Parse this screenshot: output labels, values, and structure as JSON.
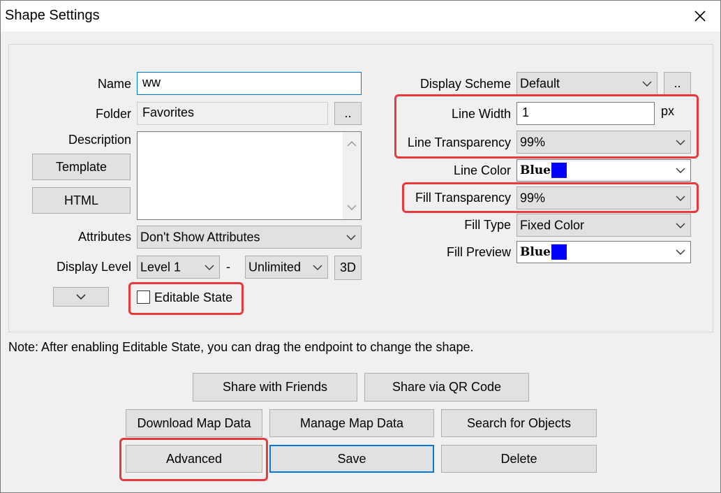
{
  "window": {
    "title": "Shape Settings"
  },
  "left": {
    "name_label": "Name",
    "name_value": "ww",
    "folder_label": "Folder",
    "folder_value": "Favorites",
    "folder_browse": "..",
    "description_label": "Description",
    "description_value": "",
    "template_button": "Template",
    "html_button": "HTML",
    "attributes_label": "Attributes",
    "attributes_value": "Don't Show Attributes",
    "display_level_label": "Display Level",
    "display_level_from": "Level 1",
    "display_level_sep": "-",
    "display_level_to": "Unlimited",
    "three_d_button": "3D",
    "editable_state_label": "Editable State",
    "editable_state_checked": false
  },
  "right": {
    "display_scheme_label": "Display Scheme",
    "display_scheme_value": "Default",
    "display_scheme_browse": "..",
    "line_width_label": "Line Width",
    "line_width_value": "1",
    "line_width_unit": "px",
    "line_transparency_label": "Line Transparency",
    "line_transparency_value": "99%",
    "line_color_label": "Line Color",
    "line_color_value": "Blue",
    "fill_transparency_label": "Fill Transparency",
    "fill_transparency_value": "99%",
    "fill_type_label": "Fill Type",
    "fill_type_value": "Fixed Color",
    "fill_preview_label": "Fill Preview",
    "fill_preview_value": "Blue"
  },
  "note": "Note: After enabling Editable State, you can drag the endpoint to change the shape.",
  "buttons": {
    "share_friends": "Share with Friends",
    "share_qr": "Share via QR Code",
    "download_map": "Download Map Data",
    "manage_map": "Manage Map Data",
    "search_objects": "Search for Objects",
    "advanced": "Advanced",
    "save": "Save",
    "delete": "Delete"
  },
  "colors": {
    "swatch_blue": "#0000ff",
    "highlight_red": "#e8393f",
    "focus_blue": "#0078d7"
  },
  "icons": {
    "close": "close-icon",
    "dropdown": "chevron-down-icon"
  }
}
